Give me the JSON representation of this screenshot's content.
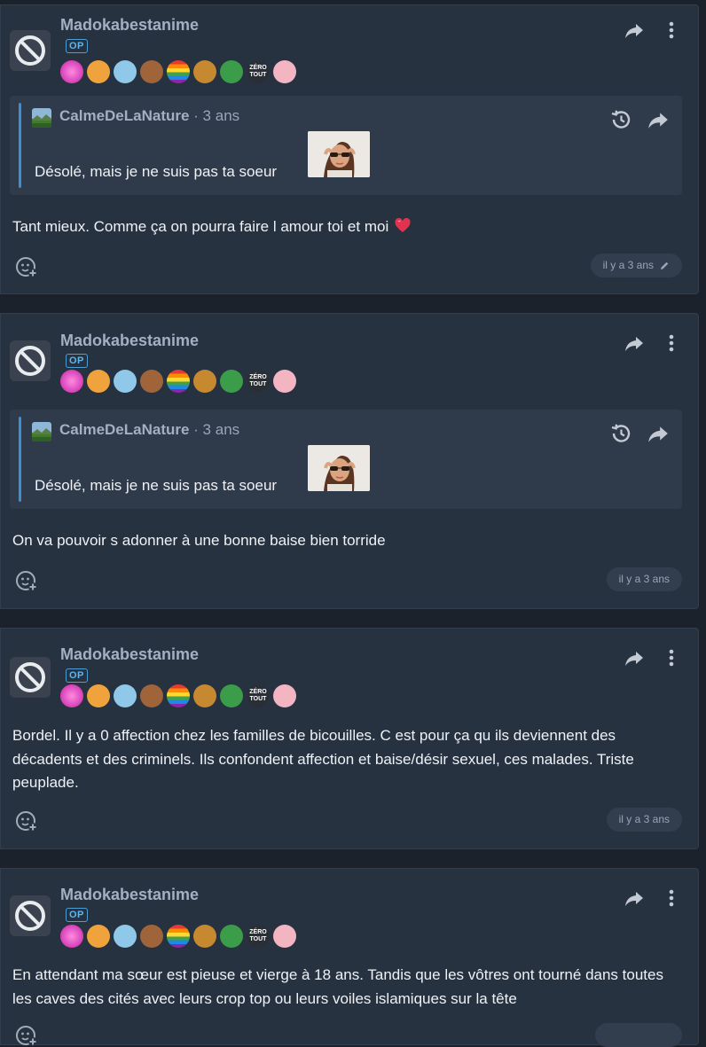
{
  "posts": [
    {
      "username": "Madokabestanime",
      "op_label": "OP",
      "quote": {
        "author": "CalmeDeLaNature",
        "time": " · 3 ans",
        "text": "Désolé, mais je ne suis pas ta soeur"
      },
      "text": "Tant mieux. Comme ça on pourra faire l amour toi et moi",
      "time": "il y a 3 ans",
      "edited": true
    },
    {
      "username": "Madokabestanime",
      "op_label": "OP",
      "quote": {
        "author": "CalmeDeLaNature",
        "time": " · 3 ans",
        "text": "Désolé, mais je ne suis pas ta soeur"
      },
      "text": "On va pouvoir s adonner à une bonne baise bien torride",
      "time": "il y a 3 ans",
      "edited": false
    },
    {
      "username": "Madokabestanime",
      "op_label": "OP",
      "text": "Bordel. Il y a 0 affection chez les familles de bicouilles. C est pour ça qu ils deviennent des décadents et des criminels. Ils confondent affection et baise/désir sexuel, ces malades. Triste peuplade.",
      "time": "il y a 3 ans",
      "edited": false
    },
    {
      "username": "Madokabestanime",
      "op_label": "OP",
      "text": "En attendant ma sœur est pieuse et vierge à 18 ans. Tandis que les vôtres ont tourné dans toutes les caves des cités avec leurs crop top ou leurs voiles islamiques sur la tête",
      "time": "",
      "edited": false
    }
  ],
  "badge_zero_text": "ZÉRO TOUT",
  "icons": {
    "avatar": "blocked-icon",
    "share": "share-arrow-icon",
    "more": "more-vertical-icon",
    "history": "history-icon",
    "react": "add-reaction-icon",
    "edit": "pencil-icon"
  },
  "colors": {
    "background": "#1b222c",
    "card": "#273241",
    "quote": "#2f3a4b",
    "quote_bar": "#3c8fd0",
    "op": "#5cb6f0",
    "username": "#a3b0c2"
  }
}
